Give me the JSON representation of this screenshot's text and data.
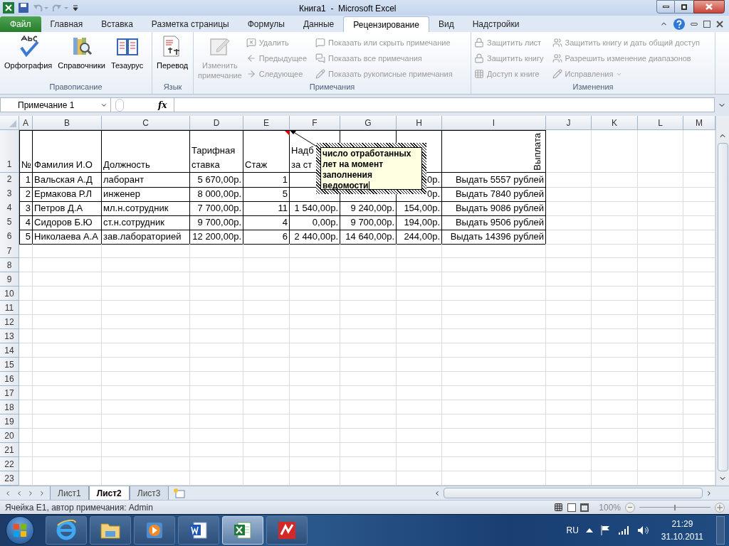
{
  "window": {
    "title": "Книга1  -  Microsoft Excel"
  },
  "ribbon_tabs": [
    {
      "label": "Файл",
      "kind": "file",
      "selected": false
    },
    {
      "label": "Главная",
      "kind": "tab",
      "selected": false
    },
    {
      "label": "Вставка",
      "kind": "tab",
      "selected": false
    },
    {
      "label": "Разметка страницы",
      "kind": "tab",
      "selected": false
    },
    {
      "label": "Формулы",
      "kind": "tab",
      "selected": false
    },
    {
      "label": "Данные",
      "kind": "tab",
      "selected": false
    },
    {
      "label": "Рецензирование",
      "kind": "tab",
      "selected": true
    },
    {
      "label": "Вид",
      "kind": "tab",
      "selected": false
    },
    {
      "label": "Надстройки",
      "kind": "tab",
      "selected": false
    }
  ],
  "ribbon_groups": [
    {
      "label": "Правописание",
      "items": [
        {
          "label": "Орфография",
          "kind": "large",
          "disabled": false
        },
        {
          "label": "Справочники",
          "kind": "large",
          "disabled": false
        },
        {
          "label": "Тезаурус",
          "kind": "large",
          "disabled": false
        }
      ]
    },
    {
      "label": "Язык",
      "items": [
        {
          "label": "Перевод",
          "kind": "large",
          "disabled": false
        }
      ]
    },
    {
      "label": "Примечания",
      "items": [
        {
          "label": "Изменить\nпримечание",
          "kind": "large",
          "disabled": true
        },
        {
          "label": "Удалить",
          "kind": "small",
          "disabled": true
        },
        {
          "label": "Предыдущее",
          "kind": "small",
          "disabled": true
        },
        {
          "label": "Следующее",
          "kind": "small",
          "disabled": true
        },
        {
          "label": "Показать или скрыть примечание",
          "kind": "small",
          "disabled": true
        },
        {
          "label": "Показать все примечания",
          "kind": "small",
          "disabled": true
        },
        {
          "label": "Показать рукописные примечания",
          "kind": "small",
          "disabled": true
        }
      ]
    },
    {
      "label": "Изменения",
      "items": [
        {
          "label": "Защитить лист",
          "kind": "small",
          "disabled": true
        },
        {
          "label": "Защитить книгу",
          "kind": "small",
          "disabled": true
        },
        {
          "label": "Доступ к книге",
          "kind": "small",
          "disabled": true
        },
        {
          "label": "Защитить книгу и дать общий доступ",
          "kind": "small",
          "disabled": true
        },
        {
          "label": "Разрешить изменение диапазонов",
          "kind": "small",
          "disabled": true
        },
        {
          "label": "Исправления",
          "kind": "dropdown",
          "disabled": true
        }
      ]
    }
  ],
  "name_box": "Примечание 1",
  "function_button": "fx",
  "columns": [
    "A",
    "B",
    "C",
    "D",
    "E",
    "F",
    "G",
    "H",
    "I",
    "J",
    "K",
    "L",
    "M"
  ],
  "rows": [
    {
      "number": "1",
      "kind": "header",
      "cells": [
        "№",
        "Фамилия И.О",
        "Должность",
        "Тарифная\nставка",
        "Стаж",
        "Надб\nза ст",
        null,
        null,
        "Выплата"
      ]
    },
    {
      "number": "2",
      "kind": "data",
      "cells": [
        "1",
        "Вальская А.Д",
        "лаборант",
        "5 670,00р.",
        "1",
        null,
        null,
        "0р.",
        "Выдать 5557 рублей"
      ]
    },
    {
      "number": "3",
      "kind": "data",
      "cells": [
        "2",
        "Ермакова Р.Л",
        "инженер",
        "8 000,00р.",
        "5",
        null,
        null,
        "0р.",
        "Выдать 7840 рублей"
      ]
    },
    {
      "number": "4",
      "kind": "data",
      "cells": [
        "3",
        "Петров Д.А",
        "мл.н.сотрудник",
        "7 700,00р.",
        "11",
        "1 540,00р.",
        "9 240,00р.",
        "154,00р.",
        "Выдать 9086 рублей"
      ]
    },
    {
      "number": "5",
      "kind": "data",
      "cells": [
        "4",
        "Сидоров Б.Ю",
        "ст.н.сотрудник",
        "9 700,00р.",
        "4",
        "0,00р.",
        "9 700,00р.",
        "194,00р.",
        "Выдать 9506 рублей"
      ]
    },
    {
      "number": "6",
      "kind": "data",
      "cells": [
        "5",
        "Николаева А.А",
        "зав.лабораторией",
        "12 200,00р.",
        "6",
        "2 440,00р.",
        "14 640,00р.",
        "244,00р.",
        "Выдать 14396 рублей"
      ]
    }
  ],
  "empty_rows": [
    "7",
    "8",
    "9",
    "10",
    "11",
    "12",
    "13",
    "14",
    "15",
    "16",
    "17",
    "18",
    "19",
    "20",
    "21",
    "22",
    "23"
  ],
  "comment": {
    "text": "число отработанных лет на момент заполнения ведомости"
  },
  "sheet_tabs": [
    {
      "label": "Лист1",
      "selected": false
    },
    {
      "label": "Лист2",
      "selected": true
    },
    {
      "label": "Лист3",
      "selected": false
    }
  ],
  "status_bar": {
    "text": "Ячейка E1, автор примечания: Admin",
    "zoom": "100%",
    "zoom_level": {
      "level": 0.5
    }
  },
  "taskbar": {
    "apps": [
      {
        "selected": false
      },
      {
        "selected": false
      },
      {
        "selected": false
      },
      {
        "selected": false
      },
      {
        "selected": true
      },
      {
        "selected": false
      }
    ],
    "language": "RU",
    "time": "21:29",
    "date": "31.10.2011"
  }
}
